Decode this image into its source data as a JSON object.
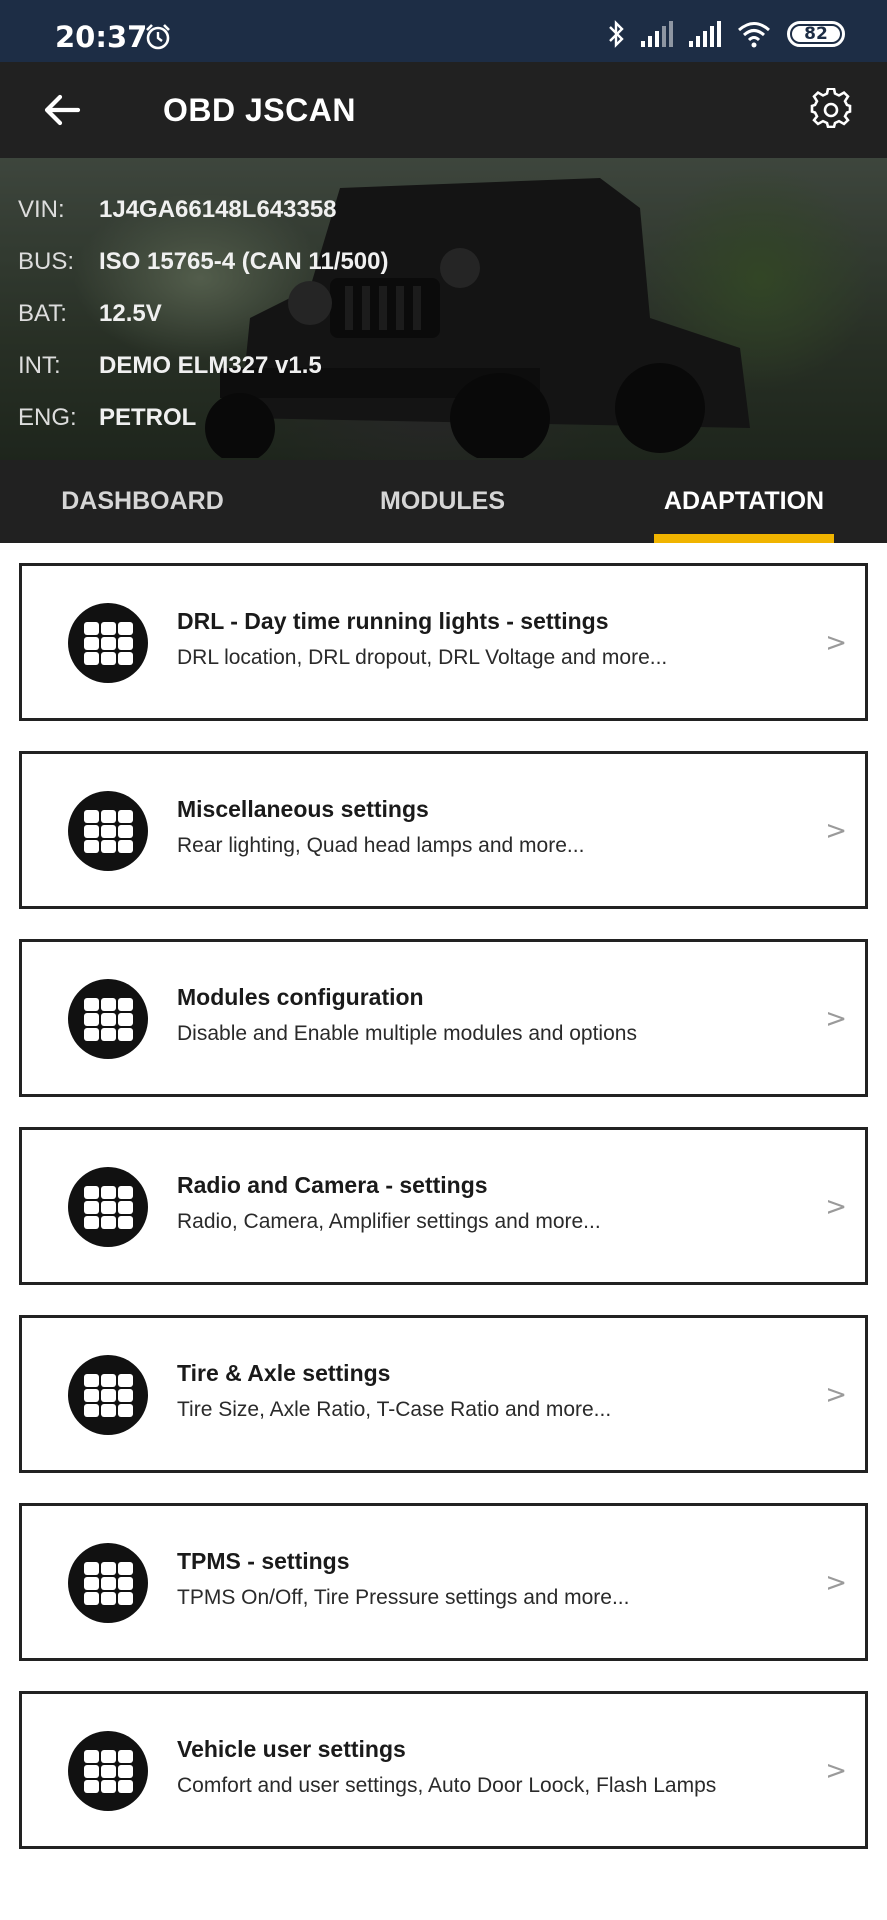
{
  "status_bar": {
    "time": "20:37",
    "icons": [
      "alarm-icon",
      "bluetooth-icon",
      "signal-icon",
      "signal-icon",
      "wifi-icon"
    ],
    "battery": "82"
  },
  "app_bar": {
    "title": "OBD JSCAN",
    "back_icon": "arrow-left-icon",
    "settings_icon": "gear-icon"
  },
  "vehicle_info": [
    {
      "label": "VIN:",
      "value": "1J4GA66148L643358"
    },
    {
      "label": "BUS:",
      "value": "ISO 15765-4 (CAN 11/500)"
    },
    {
      "label": "BAT:",
      "value": "12.5V"
    },
    {
      "label": "INT:",
      "value": "DEMO ELM327 v1.5"
    },
    {
      "label": "ENG:",
      "value": "PETROL"
    }
  ],
  "tabs": [
    {
      "label": "DASHBOARD",
      "active": false
    },
    {
      "label": "MODULES",
      "active": false
    },
    {
      "label": "ADAPTATION",
      "active": true
    }
  ],
  "accent_color": "#f0b400",
  "adaptation_items": [
    {
      "title": "DRL - Day time running lights - settings",
      "subtitle": "DRL location, DRL dropout, DRL Voltage and more...",
      "chevron": ">"
    },
    {
      "title": "Miscellaneous settings",
      "subtitle": "Rear lighting, Quad head lamps and more...",
      "chevron": ">"
    },
    {
      "title": "Modules configuration",
      "subtitle": "Disable and Enable multiple modules and options",
      "chevron": ">"
    },
    {
      "title": "Radio and Camera - settings",
      "subtitle": "Radio, Camera, Amplifier settings and more...",
      "chevron": ">"
    },
    {
      "title": "Tire & Axle settings",
      "subtitle": "Tire Size, Axle Ratio, T-Case Ratio and more...",
      "chevron": ">"
    },
    {
      "title": "TPMS - settings",
      "subtitle": "TPMS On/Off, Tire Pressure settings and more...",
      "chevron": ">"
    },
    {
      "title": "Vehicle user settings",
      "subtitle": "Comfort and user settings, Auto Door Loock, Flash Lamps",
      "chevron": ">"
    }
  ]
}
